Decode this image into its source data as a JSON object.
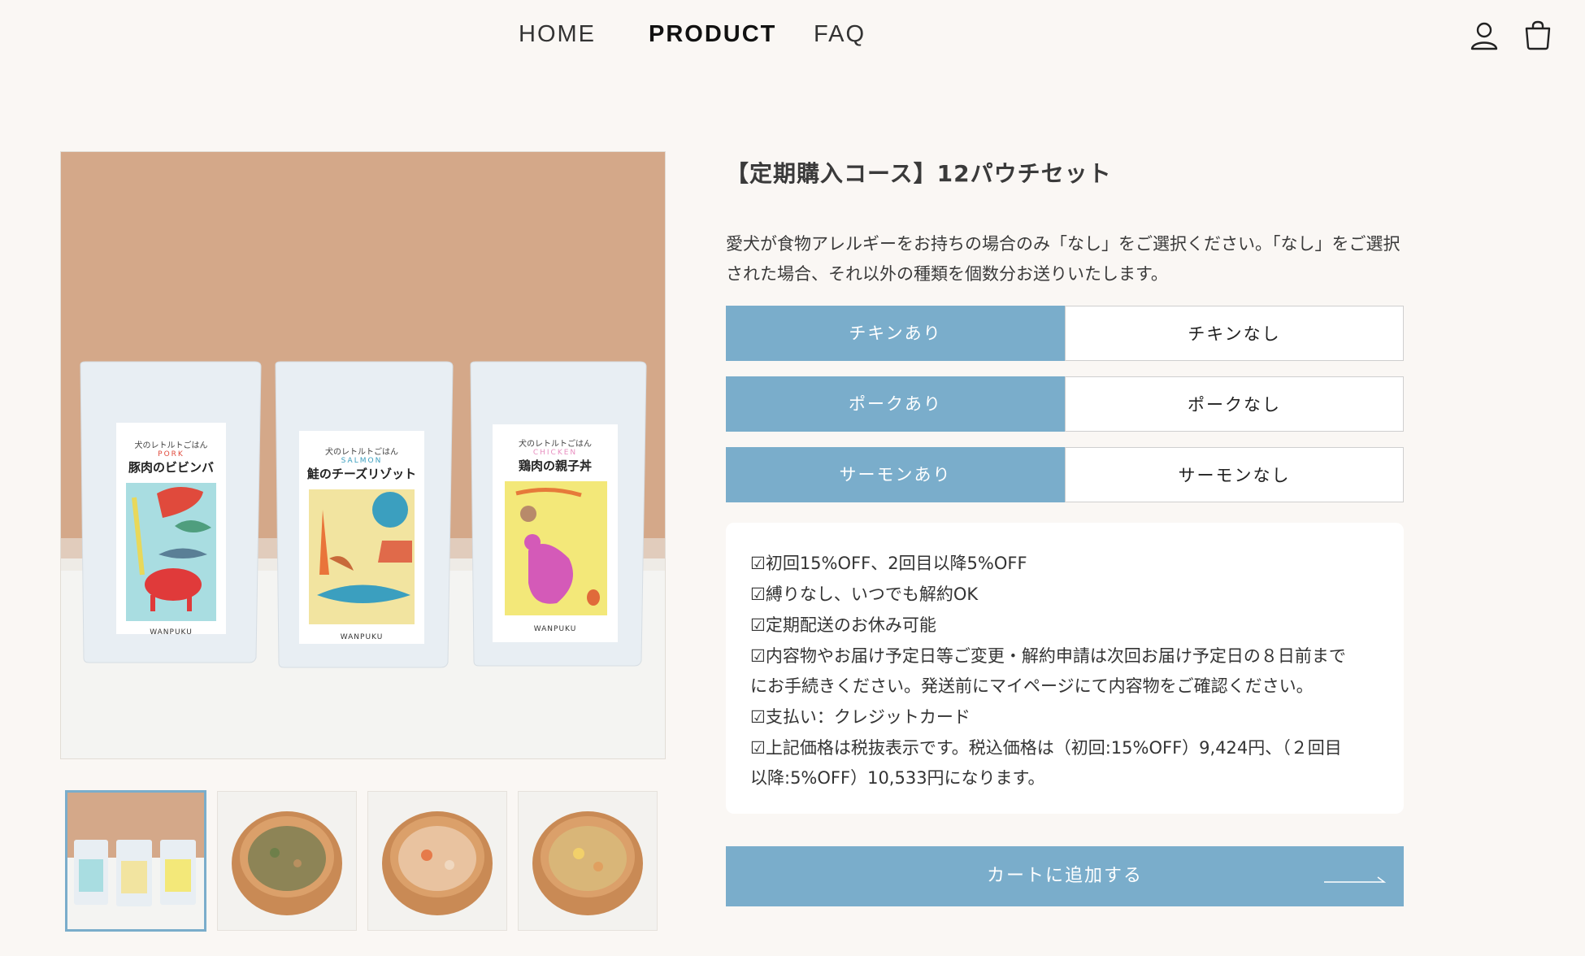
{
  "nav": {
    "links": [
      {
        "label": "HOME",
        "active": false
      },
      {
        "label": "PRODUCT",
        "active": true
      },
      {
        "label": "FAQ",
        "active": false
      }
    ],
    "icons": [
      "user-icon",
      "cart-icon"
    ]
  },
  "product": {
    "title": "【定期購入コース】12パウチセット",
    "description": "愛犬が食物アレルギーをお持ちの場合のみ「なし」をご選択ください。「なし」をご選択された場合、それ以外の種類を個数分お送りいたします。",
    "images": {
      "pouches": [
        {
          "heading": "犬のレトルトごはん",
          "english": "PORK",
          "name": "豚肉のビビンバ",
          "brand": "WANPUKU"
        },
        {
          "heading": "犬のレトルトごはん",
          "english": "SALMON",
          "name": "鮭のチーズリゾット",
          "brand": "WANPUKU"
        },
        {
          "heading": "犬のレトルトごはん",
          "english": "CHICKEN",
          "name": "鶏肉の親子丼",
          "brand": "WANPUKU"
        }
      ],
      "thumbnails": [
        "pouch-set",
        "bowl-1",
        "bowl-2",
        "bowl-3"
      ]
    },
    "options": [
      {
        "with": "チキンあり",
        "without": "チキンなし",
        "selected": "with"
      },
      {
        "with": "ポークあり",
        "without": "ポークなし",
        "selected": "with"
      },
      {
        "with": "サーモンあり",
        "without": "サーモンなし",
        "selected": "with"
      }
    ],
    "info": [
      "☑初回15%OFF、2回目以降5%OFF",
      "☑縛りなし、いつでも解約OK",
      "☑定期配送のお休み可能",
      "☑内容物やお届け予定日等ご変更・解約申請は次回お届け予定日の８日前まで",
      "にお手続きください。発送前にマイページにて内容物をご確認ください。",
      "☑支払い：クレジットカード",
      "☑上記価格は税抜表示です。税込価格は（初回:15%OFF）9,424円、（２回目",
      "以降:5%OFF）10,533円になります。"
    ],
    "cart_label": "カートに追加する"
  },
  "colors": {
    "accent": "#7aadcb",
    "background": "#faf7f4",
    "photo_backdrop": "#d4a889"
  }
}
